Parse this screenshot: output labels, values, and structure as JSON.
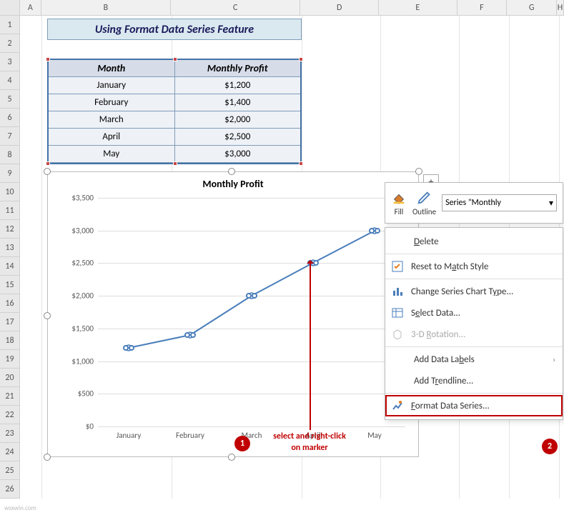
{
  "columns": [
    "A",
    "B",
    "C",
    "D",
    "E",
    "F",
    "G",
    "H"
  ],
  "row_count": 26,
  "title_cell": "Using Format Data Series Feature",
  "table": {
    "headers": [
      "Month",
      "Monthly Profit"
    ],
    "rows": [
      {
        "month": "January",
        "profit": "$1,200"
      },
      {
        "month": "February",
        "profit": "$1,400"
      },
      {
        "month": "March",
        "profit": "$2,000"
      },
      {
        "month": "April",
        "profit": "$2,500"
      },
      {
        "month": "May",
        "profit": "$3,000"
      }
    ]
  },
  "chart_data": {
    "type": "line",
    "title": "Monthly Profit",
    "categories": [
      "January",
      "February",
      "March",
      "April",
      "May"
    ],
    "values": [
      1200,
      1400,
      2000,
      2500,
      3000
    ],
    "ylim": [
      0,
      3500
    ],
    "ystep": 500,
    "y_ticks": [
      "$0",
      "$500",
      "$1,000",
      "$1,500",
      "$2,000",
      "$2,500",
      "$3,000",
      "$3,500"
    ],
    "xlabel": "",
    "ylabel": "",
    "series_name": "Monthly Profit"
  },
  "mini_toolbar": {
    "fill_label": "Fill",
    "outline_label": "Outline",
    "series_selector": "Series \"Monthly"
  },
  "context_menu": {
    "delete": "Delete",
    "reset": "Reset to Match Style",
    "change_type": "Change Series Chart Type...",
    "select_data": "Select Data...",
    "rotation": "3-D Rotation...",
    "add_labels": "Add Data Labels",
    "add_trendline": "Add Trendline...",
    "format_series": "Format Data Series..."
  },
  "callouts": {
    "num1": "1",
    "num2": "2",
    "text": "select and right-click\non marker"
  },
  "watermark": "wsxwin.com"
}
